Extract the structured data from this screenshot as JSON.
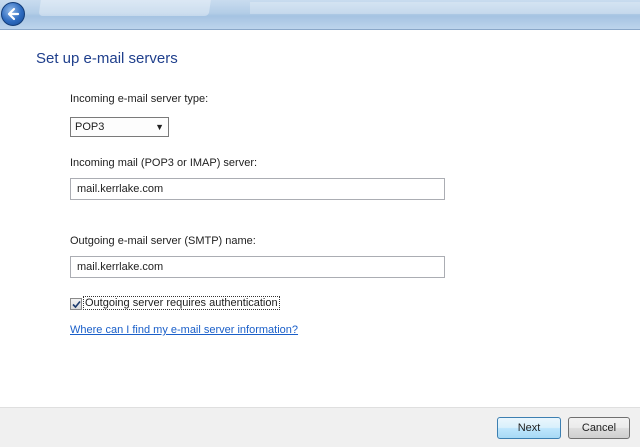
{
  "titlebar": {
    "back_icon": "back-arrow-icon"
  },
  "page": {
    "heading": "Set up e-mail servers"
  },
  "incoming_type": {
    "label": "Incoming e-mail server type:",
    "selected": "POP3"
  },
  "incoming_server": {
    "label": "Incoming mail (POP3 or IMAP) server:",
    "value": "mail.kerrlake.com"
  },
  "outgoing_server": {
    "label": "Outgoing e-mail server (SMTP) name:",
    "value": "mail.kerrlake.com"
  },
  "auth": {
    "label": "Outgoing server requires authentication",
    "checked": true
  },
  "help_link": "Where can I find my e-mail server information?",
  "footer": {
    "next_label": "Next",
    "cancel_label": "Cancel"
  }
}
